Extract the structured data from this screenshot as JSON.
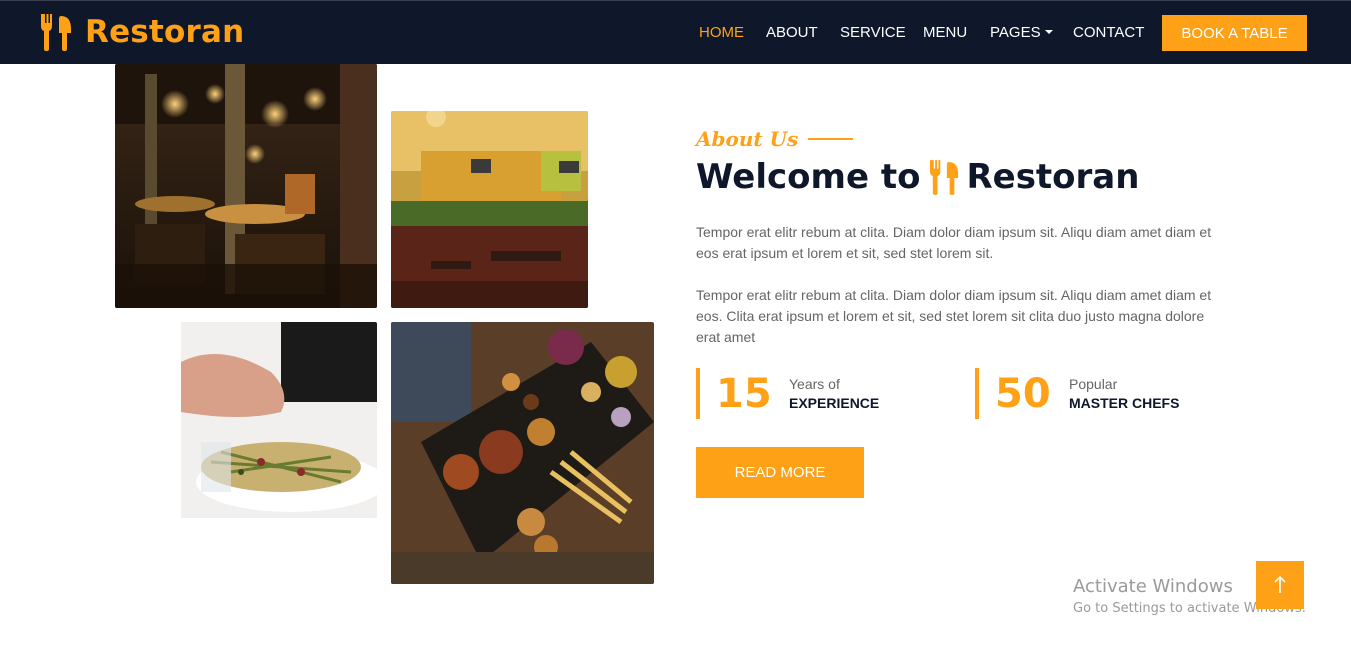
{
  "brand": {
    "name": "Restoran",
    "icon": "utensils-icon"
  },
  "nav": {
    "items": [
      "Home",
      "About",
      "Service",
      "Menu",
      "Pages",
      "Contact"
    ],
    "active": "Home",
    "cta": "Book A Table"
  },
  "about": {
    "tag": "About Us",
    "heading_prefix": "Welcome to",
    "heading_name": "Restoran",
    "para1": "Tempor erat elitr rebum at clita. Diam dolor diam ipsum sit. Aliqu diam amet diam et eos erat ipsum et lorem et sit, sed stet lorem sit.",
    "para2": "Tempor erat elitr rebum at clita. Diam dolor diam ipsum sit. Aliqu diam amet diam et eos. Clita erat ipsum et lorem et sit, sed stet lorem sit clita duo justo magna dolore erat amet",
    "stats": [
      {
        "number": "15",
        "top": "Years of",
        "bottom": "Experience"
      },
      {
        "number": "50",
        "top": "Popular",
        "bottom": "Master Chefs"
      }
    ],
    "button": "Read More"
  },
  "watermark": {
    "title": "Activate Windows",
    "subtitle": "Go to Settings to activate Windows."
  },
  "back_to_top_icon": "arrow-up-icon",
  "colors": {
    "accent": "#fea116",
    "dark": "#0f172b",
    "body_text": "#666565"
  }
}
